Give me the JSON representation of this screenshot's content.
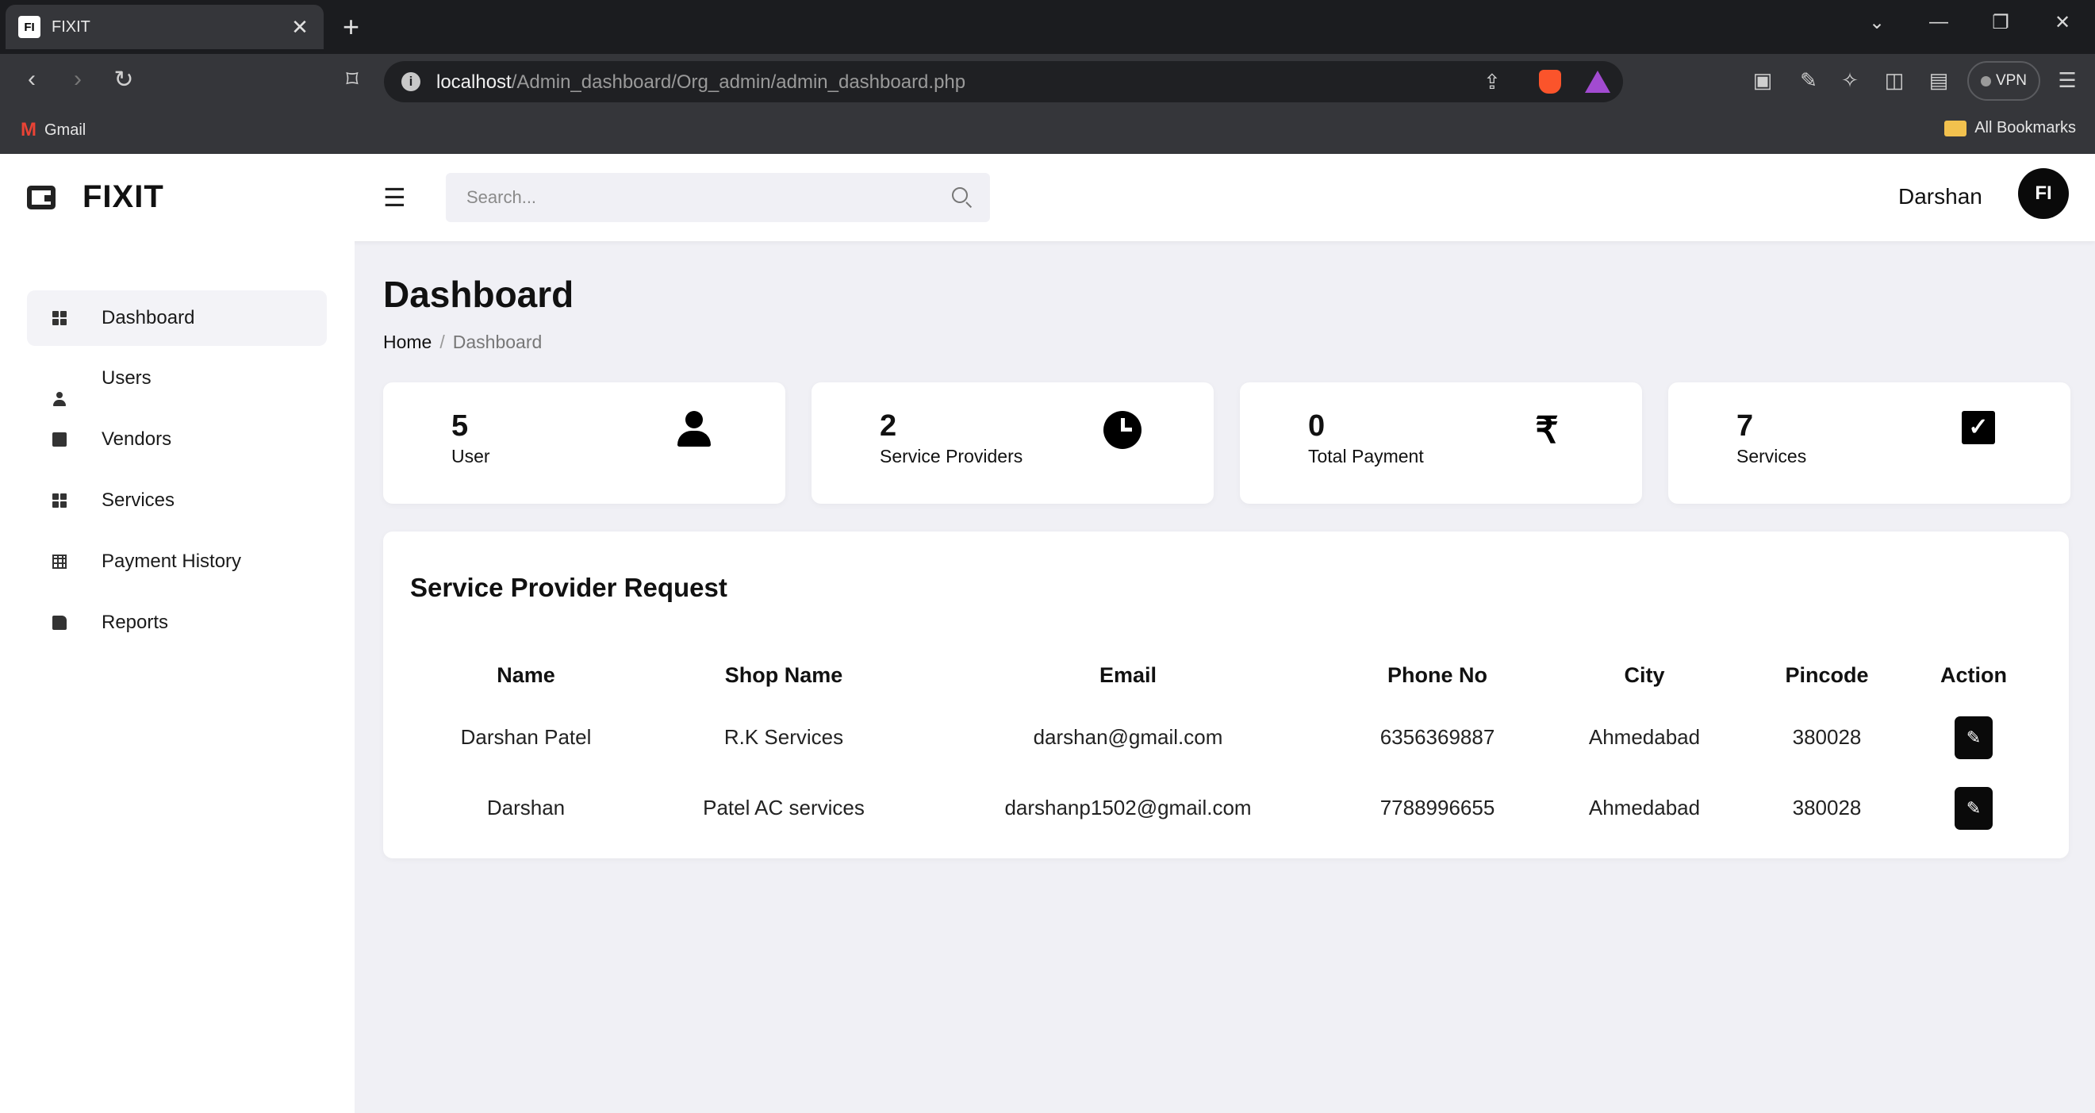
{
  "browser": {
    "tab_favicon": "FI",
    "tab_title": "FIXIT",
    "close_glyph": "✕",
    "new_tab_glyph": "+",
    "url_host": "localhost",
    "url_path": "/Admin_dashboard/Org_admin/admin_dashboard.php",
    "vpn_label": "VPN",
    "bookmarks": [
      {
        "label": "Gmail",
        "icon": "gmail-icon"
      }
    ],
    "all_bookmarks_label": "All Bookmarks"
  },
  "app": {
    "brand_name": "FIXIT",
    "search_placeholder": "Search...",
    "user_name": "Darshan",
    "avatar_text": "FI"
  },
  "sidebar": {
    "items": [
      {
        "label": "Dashboard",
        "icon": "dashboard-icon",
        "active": true
      },
      {
        "label": "Users",
        "icon": "user-icon"
      },
      {
        "label": "Vendors",
        "icon": "vendor-icon"
      },
      {
        "label": "Services",
        "icon": "services-icon"
      },
      {
        "label": "Payment History",
        "icon": "table-icon"
      },
      {
        "label": "Reports",
        "icon": "report-icon"
      }
    ]
  },
  "main": {
    "title": "Dashboard",
    "breadcrumb": {
      "home": "Home",
      "separator": "/",
      "current": "Dashboard"
    },
    "stats": [
      {
        "value": "5",
        "label": "User",
        "icon": "user-icon"
      },
      {
        "value": "2",
        "label": "Service Providers",
        "icon": "clock-icon"
      },
      {
        "value": "0",
        "label": "Total Payment",
        "icon": "rupee-icon",
        "glyph": "₹"
      },
      {
        "value": "7",
        "label": "Services",
        "icon": "check-square-icon",
        "glyph": "✓"
      }
    ],
    "request_table": {
      "title": "Service Provider Request",
      "columns": [
        "Name",
        "Shop Name",
        "Email",
        "Phone No",
        "City",
        "Pincode",
        "Action"
      ],
      "rows": [
        [
          "Darshan Patel",
          "R.K Services",
          "darshan@gmail.com",
          "6356369887",
          "Ahmedabad",
          "380028"
        ],
        [
          "Darshan",
          "Patel AC services",
          "darshanp1502@gmail.com",
          "7788996655",
          "Ahmedabad",
          "380028"
        ]
      ],
      "action_icon": "edit-icon",
      "action_glyph": "✎"
    }
  }
}
